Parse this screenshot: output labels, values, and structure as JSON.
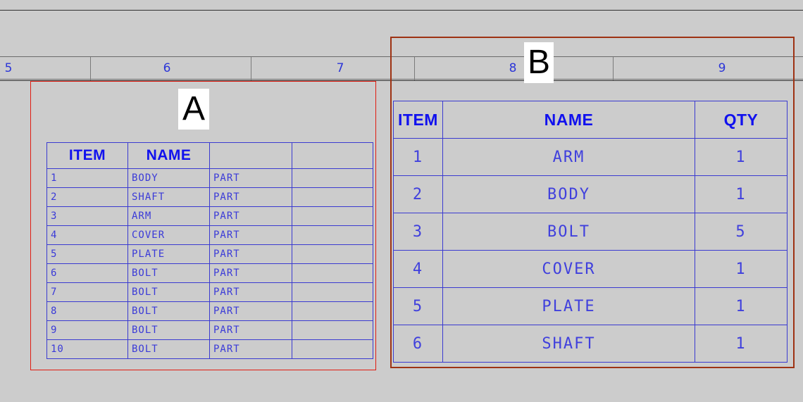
{
  "canvas": {
    "background_color": "#cccccc",
    "line_color": "#6a6a6a"
  },
  "ruler": {
    "numbers": [
      "5",
      "6",
      "7",
      "8",
      "9"
    ],
    "number_color": "#2b35d8"
  },
  "callouts": [
    {
      "label": "A",
      "name": "callout-a"
    },
    {
      "label": "B",
      "name": "callout-b"
    }
  ],
  "selection_boxes": {
    "a_color": "#e01b10",
    "b_color": "#9e3213"
  },
  "table_a": {
    "name": "bom-table-a",
    "headers": [
      "ITEM",
      "NAME",
      "",
      ""
    ],
    "rows": [
      [
        "1",
        "BODY",
        "PART",
        ""
      ],
      [
        "2",
        "SHAFT",
        "PART",
        ""
      ],
      [
        "3",
        "ARM",
        "PART",
        ""
      ],
      [
        "4",
        "COVER",
        "PART",
        ""
      ],
      [
        "5",
        "PLATE",
        "PART",
        ""
      ],
      [
        "6",
        "BOLT",
        "PART",
        ""
      ],
      [
        "7",
        "BOLT",
        "PART",
        ""
      ],
      [
        "8",
        "BOLT",
        "PART",
        ""
      ],
      [
        "9",
        "BOLT",
        "PART",
        ""
      ],
      [
        "10",
        "BOLT",
        "PART",
        ""
      ]
    ]
  },
  "table_b": {
    "name": "bom-table-b",
    "headers": [
      "ITEM",
      "NAME",
      "QTY"
    ],
    "rows": [
      [
        "1",
        "ARM",
        "1"
      ],
      [
        "2",
        "BODY",
        "1"
      ],
      [
        "3",
        "BOLT",
        "5"
      ],
      [
        "4",
        "COVER",
        "1"
      ],
      [
        "5",
        "PLATE",
        "1"
      ],
      [
        "6",
        "SHAFT",
        "1"
      ]
    ]
  }
}
